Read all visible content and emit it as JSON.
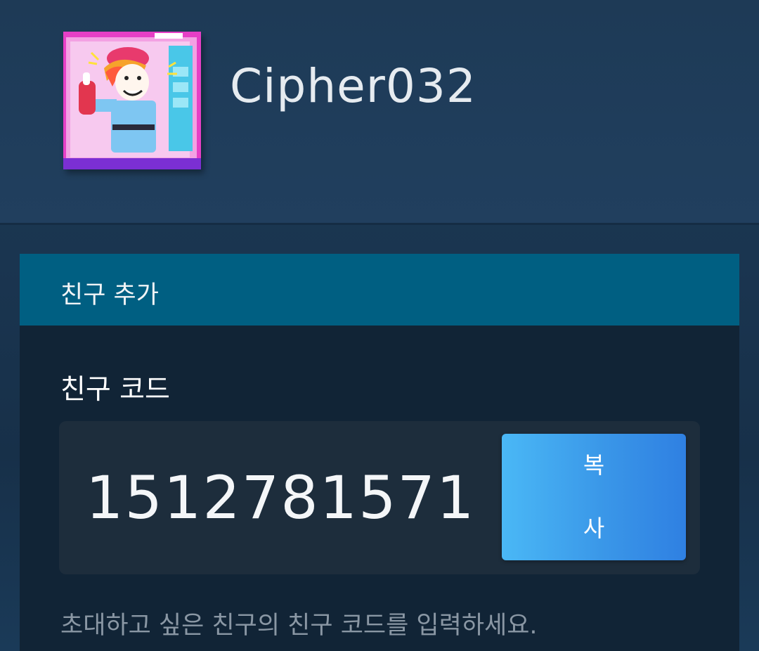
{
  "profile": {
    "username": "Cipher032",
    "avatar": "avatar-illustration"
  },
  "add_friend": {
    "title": "친구 추가",
    "code_label": "친구 코드",
    "code_value": "1512781571",
    "copy_label": "복사",
    "hint": "초대하고 싶은 친구의 친구 코드를 입력하세요."
  },
  "colors": {
    "panel_header": "#005f82",
    "panel_body": "#112436",
    "code_box": "#1d2d3c",
    "button_start": "#4ab8f6",
    "button_end": "#2f80e2"
  }
}
